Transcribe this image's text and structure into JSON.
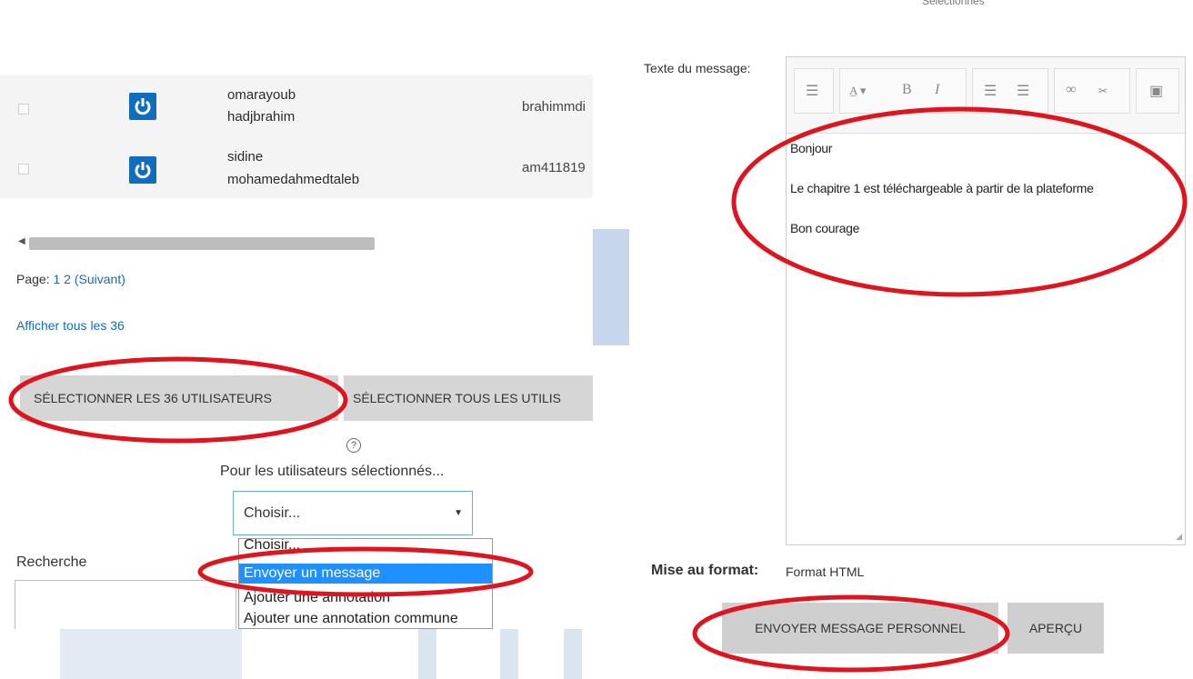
{
  "left": {
    "users": [
      {
        "first": "omarayoub",
        "last": "hadjbrahim",
        "email": "brahimmdi"
      },
      {
        "first": "sidine",
        "last": "mohamedahmedtaleb",
        "email": "am411819"
      }
    ],
    "pager": {
      "label": "Page:",
      "page1": "1",
      "page2": "2",
      "next": "(Suivant)"
    },
    "show_all": "Afficher tous les 36",
    "select_page_btn": "SÉLECTIONNER LES 36 UTILISATEURS",
    "select_all_btn": "SÉLECTIONNER TOUS LES UTILIS",
    "with_selected_label": "Pour les utilisateurs sélectionnés...",
    "select": {
      "value": "Choisir...",
      "options": [
        "Choisir...",
        "Envoyer un message",
        "Ajouter une annotation",
        "Ajouter une annotation commune"
      ],
      "highlighted_index": 1
    },
    "search_label": "Recherche"
  },
  "right": {
    "top_cut_text": "Sélectionnés",
    "message_label": "Texte du message:",
    "message_lines": [
      "Bonjour",
      "Le chapitre 1 est téléchargeable à partir de la plateforme",
      "Bon courage"
    ],
    "format_label": "Mise au format:",
    "format_value": "Format HTML",
    "send_btn": "ENVOYER MESSAGE PERSONNEL",
    "preview_btn": "APERÇU"
  },
  "colors": {
    "accent": "#0f6cbf",
    "highlight": "#1e90ff",
    "annotation": "#e0141e",
    "button": "#d6d6d6"
  },
  "icons": [
    "power-avatar-icon",
    "help-icon",
    "dropdown-caret-icon",
    "scroll-arrow-icon",
    "resize-grip-icon",
    "toolbar-icons"
  ]
}
